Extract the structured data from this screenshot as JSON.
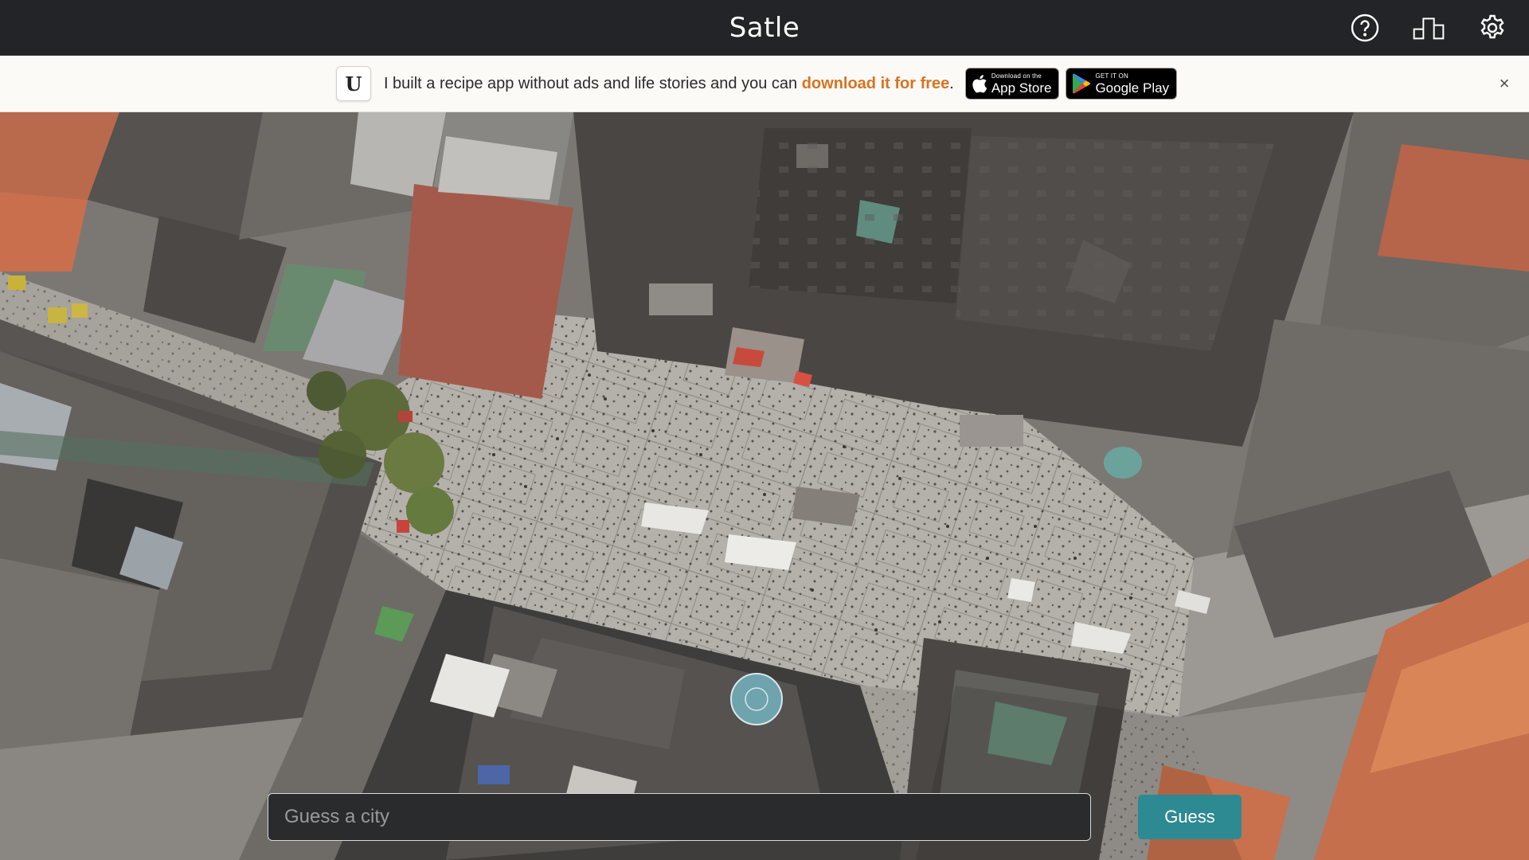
{
  "app": {
    "title": "Satle"
  },
  "header": {
    "icons": [
      "help-icon",
      "stats-icon",
      "settings-icon"
    ]
  },
  "banner": {
    "logo_letter": "U",
    "message": "I built a recipe app without ads and life stories and you can ",
    "link_text": "download it for free",
    "message_end": ".",
    "app_store": {
      "small": "Download on the",
      "big": "App Store"
    },
    "google_play": {
      "small": "GET IT ON",
      "big": "Google Play"
    },
    "close": "×"
  },
  "guess": {
    "placeholder": "Guess a city",
    "button_label": "Guess"
  },
  "colors": {
    "header_bg": "#222427",
    "banner_bg": "#fbfaf6",
    "link": "#d9731f",
    "button": "#2d8a93"
  }
}
